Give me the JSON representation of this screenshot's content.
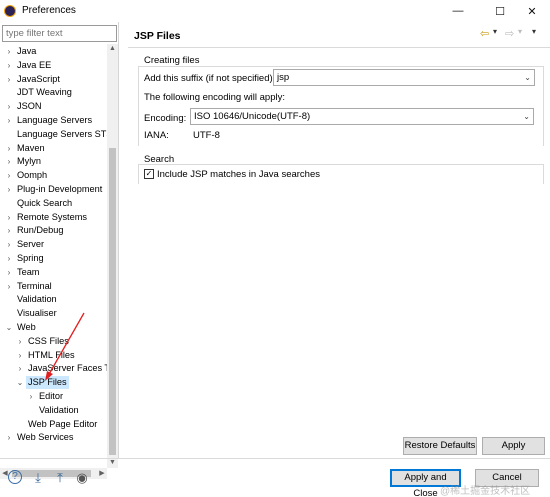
{
  "window": {
    "title": "Preferences",
    "controls": {
      "minimize": "—",
      "maximize": "☐",
      "close": "✕"
    }
  },
  "sidebar": {
    "filter_placeholder": "type filter text",
    "items": [
      {
        "label": "Java",
        "arrow": "›",
        "level": 0
      },
      {
        "label": "Java EE",
        "arrow": "›",
        "level": 0
      },
      {
        "label": "JavaScript",
        "arrow": "›",
        "level": 0
      },
      {
        "label": "JDT Weaving",
        "arrow": "",
        "level": 0
      },
      {
        "label": "JSON",
        "arrow": "›",
        "level": 0
      },
      {
        "label": "Language Servers",
        "arrow": "›",
        "level": 0
      },
      {
        "label": "Language Servers STS",
        "arrow": "",
        "level": 0
      },
      {
        "label": "Maven",
        "arrow": "›",
        "level": 0
      },
      {
        "label": "Mylyn",
        "arrow": "›",
        "level": 0
      },
      {
        "label": "Oomph",
        "arrow": "›",
        "level": 0
      },
      {
        "label": "Plug-in Development",
        "arrow": "›",
        "level": 0
      },
      {
        "label": "Quick Search",
        "arrow": "",
        "level": 0
      },
      {
        "label": "Remote Systems",
        "arrow": "›",
        "level": 0
      },
      {
        "label": "Run/Debug",
        "arrow": "›",
        "level": 0
      },
      {
        "label": "Server",
        "arrow": "›",
        "level": 0
      },
      {
        "label": "Spring",
        "arrow": "›",
        "level": 0
      },
      {
        "label": "Team",
        "arrow": "›",
        "level": 0
      },
      {
        "label": "Terminal",
        "arrow": "›",
        "level": 0
      },
      {
        "label": "Validation",
        "arrow": "",
        "level": 0
      },
      {
        "label": "Visualiser",
        "arrow": "",
        "level": 0
      },
      {
        "label": "Web",
        "arrow": "⌄",
        "level": 0
      },
      {
        "label": "CSS Files",
        "arrow": "›",
        "level": 1
      },
      {
        "label": "HTML Files",
        "arrow": "›",
        "level": 1
      },
      {
        "label": "JavaServer Faces Tools",
        "arrow": "›",
        "level": 1
      },
      {
        "label": "JSP Files",
        "arrow": "⌄",
        "level": 1,
        "selected": true
      },
      {
        "label": "Editor",
        "arrow": "›",
        "level": 2
      },
      {
        "label": "Validation",
        "arrow": "",
        "level": 2
      },
      {
        "label": "Web Page Editor",
        "arrow": "",
        "level": 1
      },
      {
        "label": "Web Services",
        "arrow": "›",
        "level": 0
      }
    ]
  },
  "page": {
    "title": "JSP Files",
    "nav": {
      "back": "⇦",
      "back_menu": "▾",
      "forward": "⇨",
      "forward_menu": "▾",
      "view_menu": "▾"
    },
    "creating_files": {
      "group_label": "Creating files",
      "suffix_label": "Add this suffix (if not specified):",
      "suffix_value": "jsp",
      "encoding_intro": "The following encoding will apply:",
      "encoding_label": "Encoding:",
      "encoding_value": "ISO 10646/Unicode(UTF-8)",
      "iana_label": "IANA:",
      "iana_value": "UTF-8"
    },
    "search": {
      "group_label": "Search",
      "include_jsp_label": "Include JSP matches in Java searches",
      "include_jsp_checked": true
    },
    "restore_defaults": "Restore Defaults",
    "apply": "Apply"
  },
  "footer": {
    "apply_and_close": "Apply and Close",
    "cancel": "Cancel",
    "icons": [
      "help-icon",
      "import-icon",
      "export-icon",
      "record-icon"
    ]
  },
  "watermark": "@稀土掘金技术社区"
}
